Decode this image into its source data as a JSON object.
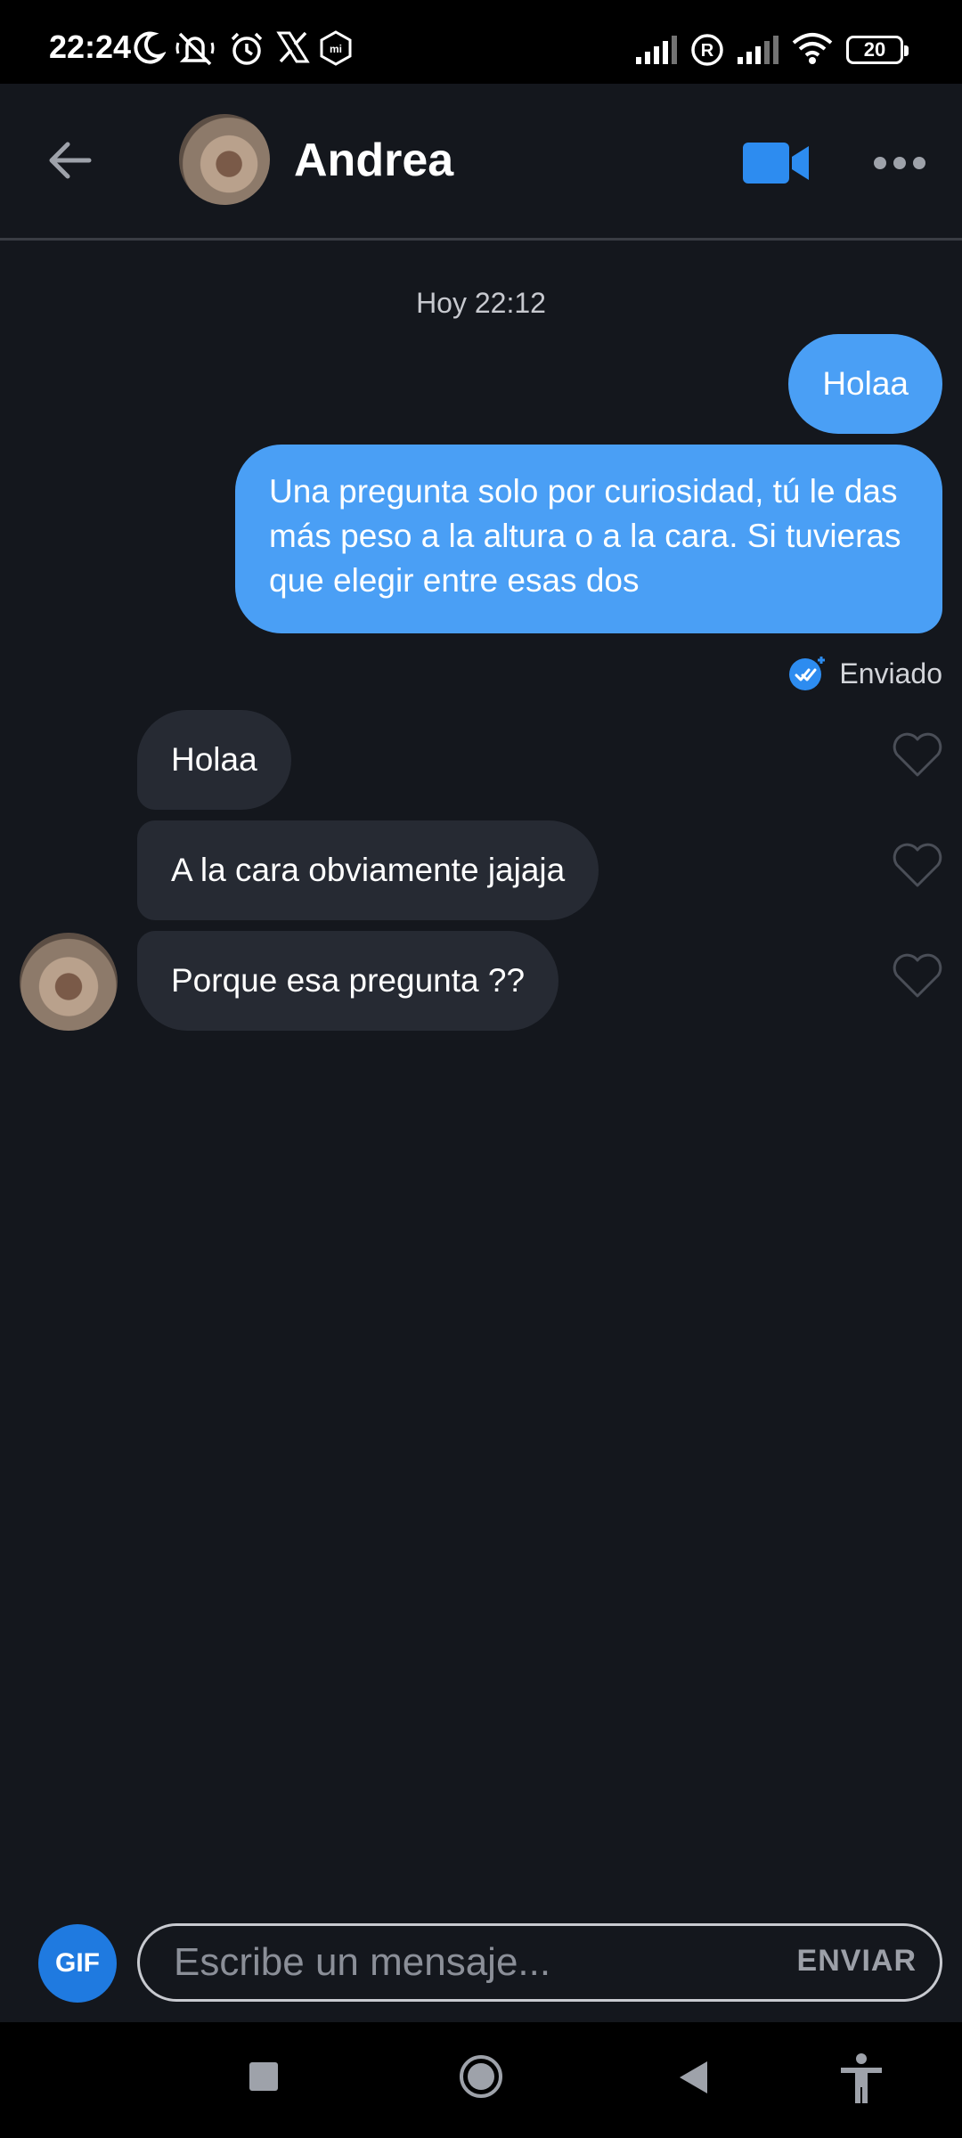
{
  "status_bar": {
    "time": "22:24",
    "battery": "20",
    "icons": [
      "moon-icon",
      "silent-icon",
      "alarm-icon",
      "x-logo-icon",
      "mi-icon",
      "signal-icon",
      "registered-icon",
      "signal-icon",
      "wifi-icon",
      "battery-icon"
    ]
  },
  "header": {
    "contact_name": "Andrea",
    "icons": [
      "arrow-left-icon",
      "video-camera-icon",
      "more-dots-icon"
    ],
    "accent_color": "#2d8cf0"
  },
  "chat": {
    "timestamp": "Hoy 22:12",
    "outgoing": [
      {
        "text": "Holaa"
      },
      {
        "text": "Una pregunta solo por curiosidad, tú le das más peso a la altura o a la cara. Si tuvieras que elegir entre esas dos"
      }
    ],
    "sent_status": "Enviado",
    "incoming": [
      {
        "text": "Holaa"
      },
      {
        "text": "A la cara obviamente jajaja"
      },
      {
        "text": "Porque esa pregunta ??"
      }
    ],
    "outgoing_bubble_color": "#4a9ff5",
    "incoming_bubble_color": "#262a33"
  },
  "composer": {
    "gif_label": "GIF",
    "placeholder": "Escribe un mensaje...",
    "send_label": "ENVIAR"
  },
  "nav_bar": {
    "icons": [
      "square-icon",
      "home-circle-icon",
      "back-triangle-icon",
      "accessibility-icon"
    ]
  }
}
